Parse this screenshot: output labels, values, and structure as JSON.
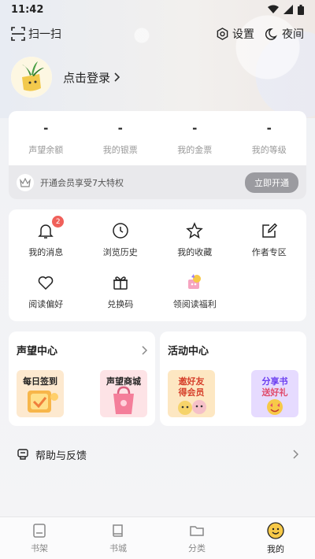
{
  "status_bar": {
    "time": "11:42"
  },
  "toolbar": {
    "scan_label": "扫一扫",
    "settings_label": "设置",
    "night_label": "夜间"
  },
  "login": {
    "label": "点击登录"
  },
  "stats": [
    {
      "value": "-",
      "label": "声望余额"
    },
    {
      "value": "-",
      "label": "我的银票"
    },
    {
      "value": "-",
      "label": "我的金票"
    },
    {
      "value": "-",
      "label": "我的等级"
    }
  ],
  "vip": {
    "text": "开通会员享受7大特权",
    "button": "立即开通"
  },
  "menu": [
    {
      "label": "我的消息",
      "icon": "bell-icon",
      "badge": "2"
    },
    {
      "label": "浏览历史",
      "icon": "clock-icon"
    },
    {
      "label": "我的收藏",
      "icon": "star-icon"
    },
    {
      "label": "作者专区",
      "icon": "edit-icon"
    },
    {
      "label": "阅读偏好",
      "icon": "heart-icon"
    },
    {
      "label": "兑换码",
      "icon": "gift-icon"
    },
    {
      "label": "领阅读福利",
      "icon": "reward-icon"
    }
  ],
  "reputation_center": {
    "title": "声望中心",
    "tiles": [
      {
        "label": "每日签到",
        "color": "#fde9cf"
      },
      {
        "label": "声望商城",
        "color": "#fde3e6"
      }
    ]
  },
  "activity_center": {
    "title": "活动中心",
    "tiles": [
      {
        "label": "邀好友",
        "sublabel": "得会员",
        "color": "#fde7c2"
      },
      {
        "label": "分享书",
        "sublabel": "送好礼",
        "color": "#e6dbff"
      }
    ]
  },
  "help": {
    "label": "帮助与反馈"
  },
  "bottom_nav": [
    {
      "label": "书架",
      "icon": "bookshelf-icon"
    },
    {
      "label": "书城",
      "icon": "bookstore-icon"
    },
    {
      "label": "分类",
      "icon": "folder-icon"
    },
    {
      "label": "我的",
      "icon": "smile-icon",
      "active": true
    }
  ]
}
